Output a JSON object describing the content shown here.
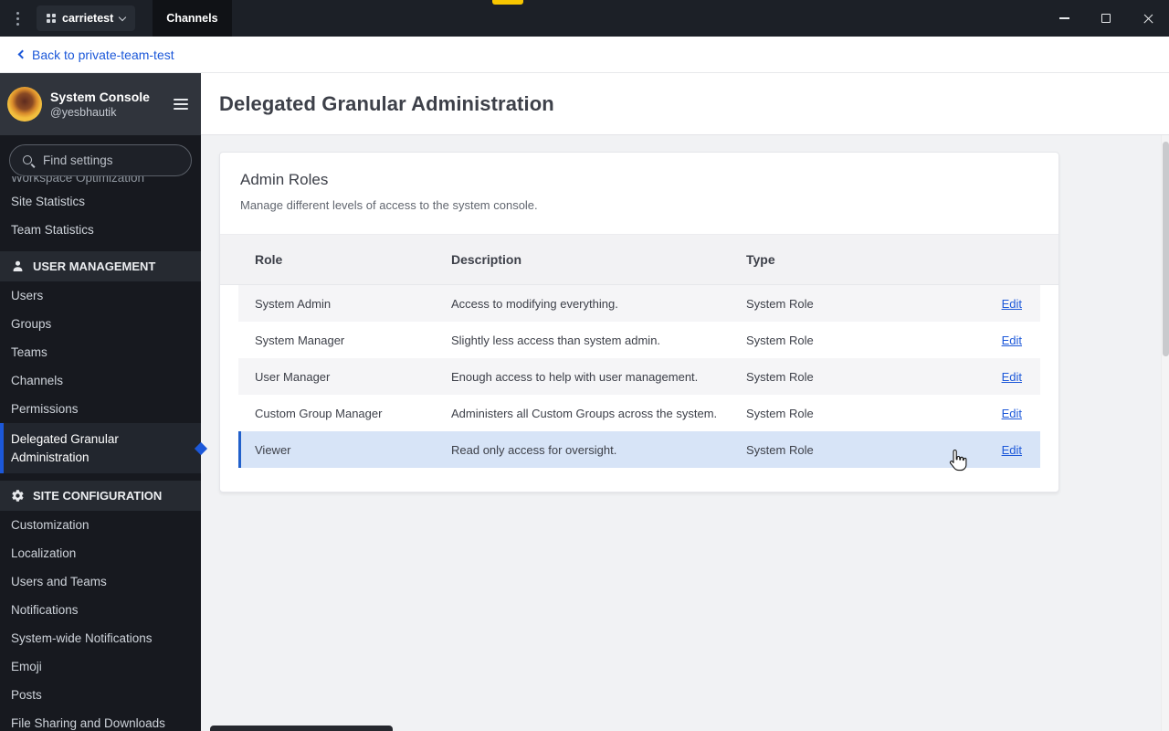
{
  "titlebar": {
    "server_name": "carrietest",
    "tab_label": "Channels"
  },
  "backbar": {
    "back_label": "Back to private-team-test"
  },
  "sidebar": {
    "title": "System Console",
    "username": "@yesbhautik",
    "search_placeholder": "Find settings",
    "scrolled_out_item": "Workspace Optimization",
    "top_items": [
      "Site Statistics",
      "Team Statistics"
    ],
    "sections": [
      {
        "header": "USER MANAGEMENT",
        "items": [
          "Users",
          "Groups",
          "Teams",
          "Channels",
          "Permissions",
          "Delegated Granular Administration"
        ],
        "active_item": "Delegated Granular Administration"
      },
      {
        "header": "SITE CONFIGURATION",
        "items": [
          "Customization",
          "Localization",
          "Users and Teams",
          "Notifications",
          "System-wide Notifications",
          "Emoji",
          "Posts",
          "File Sharing and Downloads"
        ]
      }
    ]
  },
  "main": {
    "page_title": "Delegated Granular Administration",
    "card": {
      "title": "Admin Roles",
      "subtitle": "Manage different levels of access to the system console.",
      "table": {
        "columns": [
          "Role",
          "Description",
          "Type"
        ],
        "edit_label": "Edit",
        "highlighted_row": "Viewer",
        "rows": [
          {
            "role": "System Admin",
            "description": "Access to modifying everything.",
            "type": "System Role"
          },
          {
            "role": "System Manager",
            "description": "Slightly less access than system admin.",
            "type": "System Role"
          },
          {
            "role": "User Manager",
            "description": "Enough access to help with user management.",
            "type": "System Role"
          },
          {
            "role": "Custom Group Manager",
            "description": "Administers all Custom Groups across the system.",
            "type": "System Role"
          },
          {
            "role": "Viewer",
            "description": "Read only access for oversight.",
            "type": "System Role"
          }
        ]
      }
    }
  },
  "colors": {
    "accent": "#1c58d9",
    "row_highlight": "#d7e4f7",
    "titlebar_bg": "#1c2027",
    "sidebar_bg": "#17191f"
  },
  "icons": {
    "app_menu": "kebab-vertical",
    "server": "grid",
    "server_expand": "chevron-down",
    "back": "chevron-left",
    "search": "magnifier",
    "sidebar_menu": "hamburger",
    "user_management": "person",
    "site_configuration": "gear",
    "window_controls": [
      "minimize",
      "maximize",
      "close"
    ]
  }
}
